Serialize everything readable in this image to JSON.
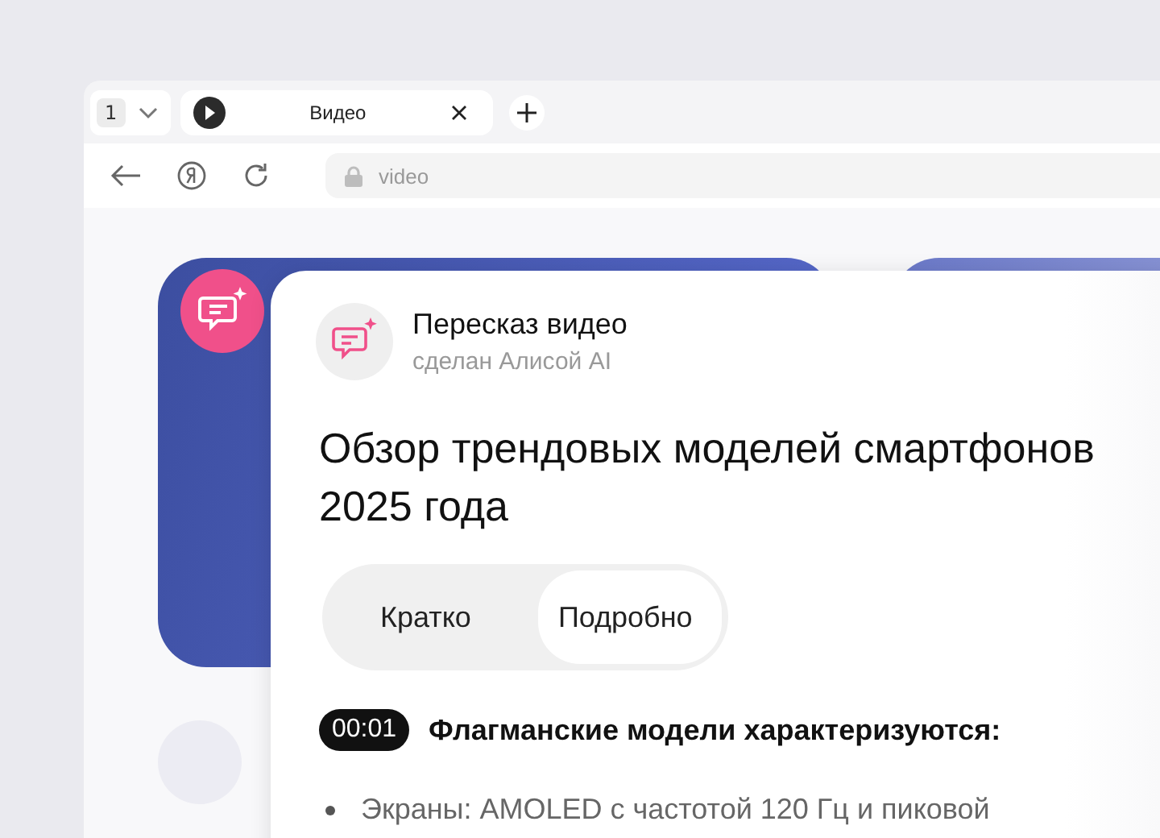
{
  "browser": {
    "tab_counter": "1",
    "tabs": [
      {
        "title": "Видео",
        "selected": true
      }
    ],
    "address": "video"
  },
  "summary": {
    "title": "Пересказ видео",
    "subtitle": "сделан Алисой AI",
    "heading": "Обзор трендовых моделей смартфонов 2025 года",
    "modes": [
      {
        "label": "Кратко",
        "selected": false
      },
      {
        "label": "Подробно",
        "selected": true
      }
    ],
    "sections": [
      {
        "time": "00:01",
        "heading": "Флагманские модели характеризуются:",
        "bullets": [
          "Экраны: AMOLED с частотой 120 Гц и пиковой"
        ]
      }
    ]
  }
}
